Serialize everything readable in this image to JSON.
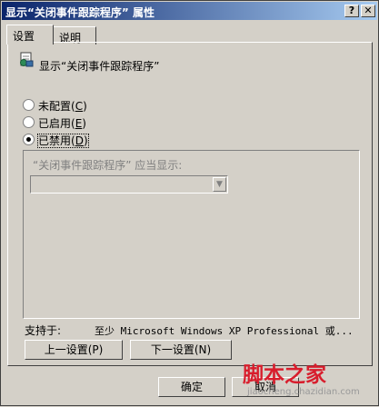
{
  "window": {
    "title": "显示“关闭事件跟踪程序” 属性",
    "help_icon": "?",
    "close_icon": "✕"
  },
  "tabs": [
    {
      "label": "设置",
      "active": true
    },
    {
      "label": "说明",
      "active": false
    }
  ],
  "policy": {
    "icon": "policy-setting-icon",
    "name": "显示“关闭事件跟踪程序”"
  },
  "options": [
    {
      "label": "未配置",
      "hotkey": "C",
      "checked": false
    },
    {
      "label": "已启用",
      "hotkey": "E",
      "checked": false
    },
    {
      "label": "已禁用",
      "hotkey": "D",
      "checked": true
    }
  ],
  "group": {
    "label": "“关闭事件跟踪程序” 应当显示:",
    "combo_value": ""
  },
  "supported": {
    "label": "支持于:",
    "value": "至少 Microsoft Windows XP Professional 或..."
  },
  "nav_buttons": {
    "prev": "上一设置(P)",
    "next": "下一设置(N)"
  },
  "dialog_buttons": {
    "ok": "确定",
    "cancel": "取消"
  },
  "watermark": {
    "logo_text": "脚本之家",
    "url": "jiaocheng.chazidian.com",
    "color": "#d81d2c"
  }
}
